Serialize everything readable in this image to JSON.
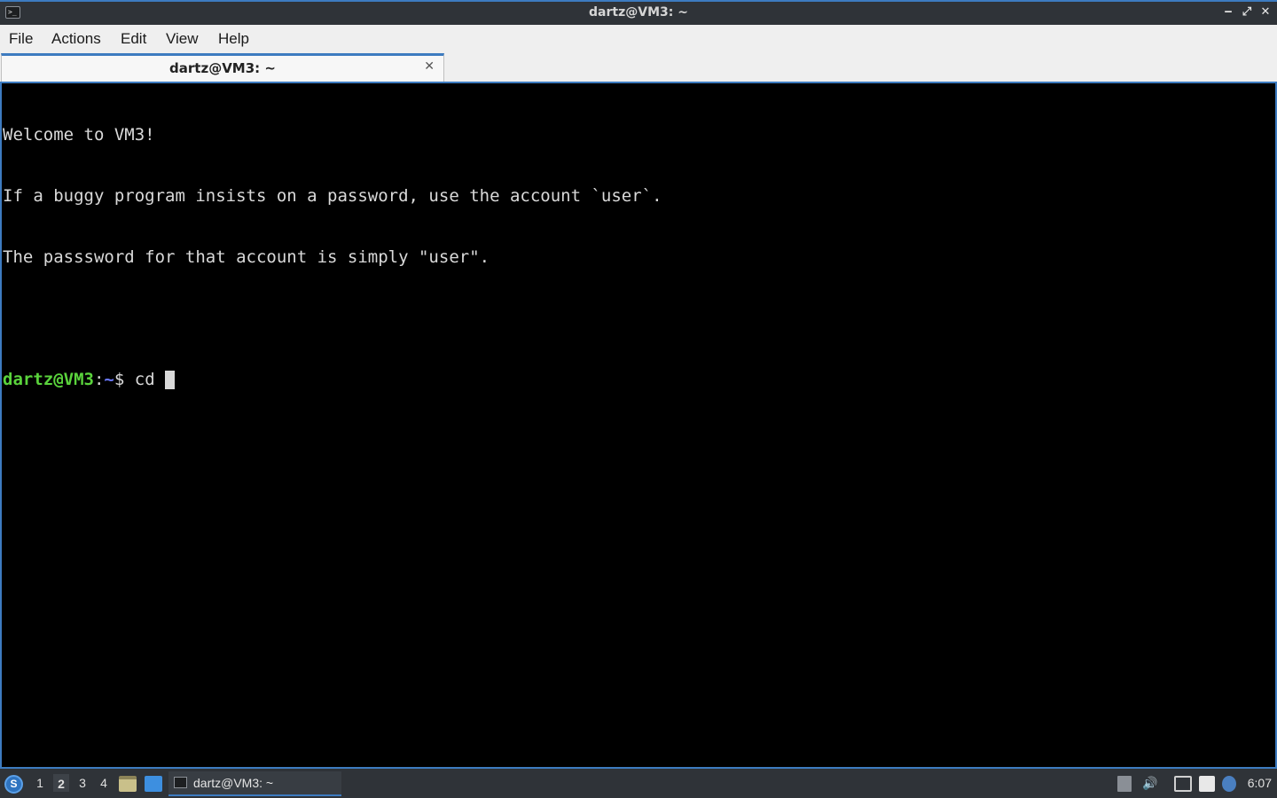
{
  "window": {
    "title": "dartz@VM3: ~",
    "minimize": "‒",
    "maximize": "⤢",
    "close": "✕",
    "icon_text": ">_"
  },
  "menu": {
    "items": [
      "File",
      "Actions",
      "Edit",
      "View",
      "Help"
    ]
  },
  "tab": {
    "label": "dartz@VM3: ~",
    "close": "✕"
  },
  "terminal": {
    "lines": [
      "Welcome to VM3!",
      "If a buggy program insists on a password, use the account `user`.",
      "The passsword for that account is simply \"user\".",
      ""
    ],
    "prompt_user_host": "dartz@VM3",
    "prompt_sep": ":",
    "prompt_path": "~",
    "prompt_symbol": "$ ",
    "command": "cd "
  },
  "taskbar": {
    "workspaces": [
      "1",
      "2",
      "3",
      "4"
    ],
    "active_workspace": "2",
    "task_label": "dartz@VM3: ~",
    "clock": "6:07",
    "start_icon": "start-menu-icon"
  },
  "colors": {
    "accent": "#3d7bc0",
    "prompt_user": "#5ad33c",
    "prompt_path": "#6a78ff",
    "terminal_bg": "#000000",
    "terminal_fg": "#d9d9d9"
  }
}
